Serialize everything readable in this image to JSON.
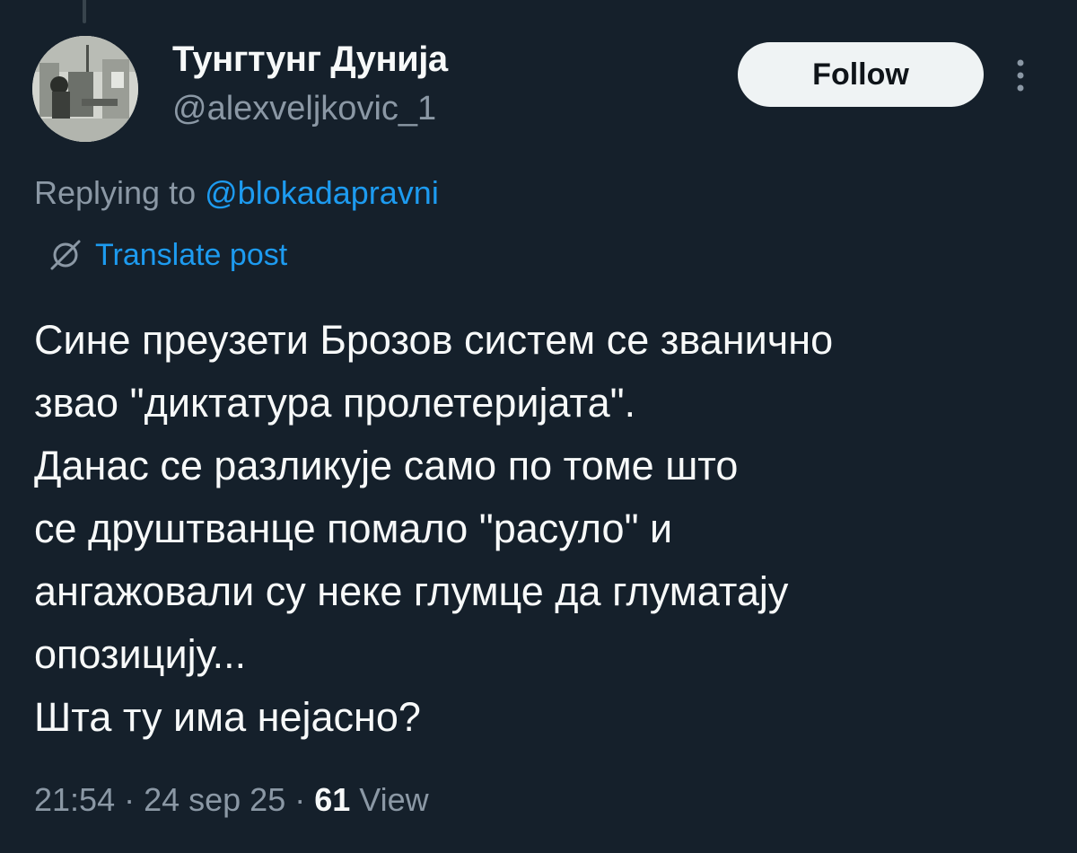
{
  "author": {
    "display_name": "Тунгтунг Дунија",
    "handle": "@alexveljkovic_1"
  },
  "actions": {
    "follow_label": "Follow",
    "more_icon": "more-vertical-icon"
  },
  "reply": {
    "prefix": "Replying to",
    "mention": "@blokadapravni"
  },
  "translate": {
    "label": "Translate post",
    "icon": "translate-icon"
  },
  "post": {
    "lines": [
      "Сине преузети Брозов систем се званично",
      "звао \"диктатура пролетеријата\".",
      "Данас се разликује само по томе што",
      "се друштванце помало \"расуло\" и",
      "ангажовали су неке глумце да глуматају",
      "опозицију...",
      "Шта ту има нејасно?"
    ]
  },
  "meta": {
    "time": "21:54",
    "date": "24 sep 25",
    "views_count": "61",
    "views_label": "View",
    "separator": "·"
  },
  "colors": {
    "background": "#15202b",
    "text_primary": "#f7f9f9",
    "text_secondary": "#8b98a5",
    "accent": "#1d9bf0",
    "follow_bg": "#eff3f4"
  }
}
